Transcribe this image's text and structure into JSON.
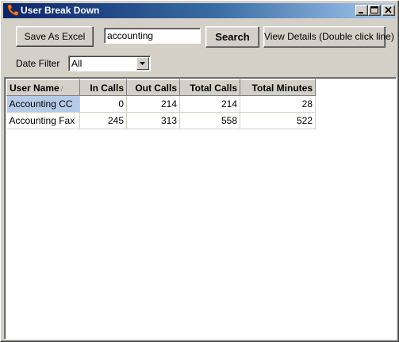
{
  "window": {
    "title": "User Break Down"
  },
  "toolbar": {
    "excel_label": "Save As Excel",
    "search_value": "accounting",
    "search_label": "Search",
    "details_label": "View Details (Double click line)"
  },
  "filter": {
    "label": "Date Filter",
    "selected": "All"
  },
  "grid": {
    "columns": [
      "User Name",
      "In Calls",
      "Out Calls",
      "Total Calls",
      "Total Minutes"
    ],
    "sort_glyph": "/",
    "rows": [
      [
        "Accounting CC",
        "0",
        "214",
        "214",
        "28"
      ],
      [
        "Accounting Fax",
        "245",
        "313",
        "558",
        "522"
      ]
    ]
  }
}
